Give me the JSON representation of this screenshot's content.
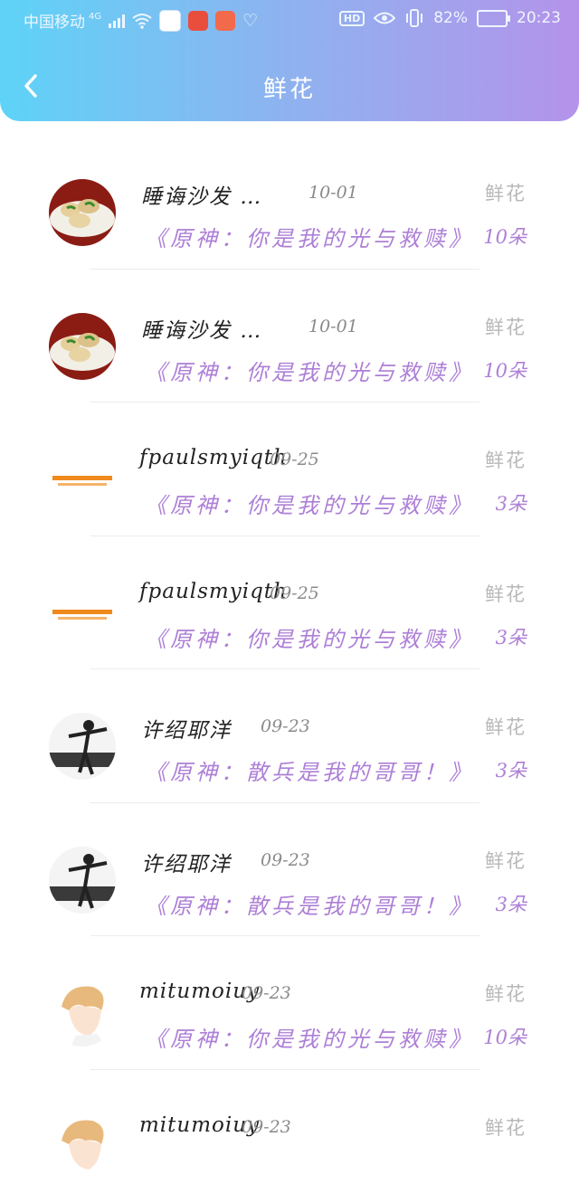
{
  "status_bar": {
    "carrier": "中国移动",
    "network": "4G",
    "battery_percent": "82%",
    "time": "20:23"
  },
  "header": {
    "title": "鲜花",
    "back_icon": "chevron-left-icon"
  },
  "records": [
    {
      "name": "睡诲沙发 …",
      "date": "10-01",
      "kind": "鲜花",
      "work": "《原神：你是我的光与救赎》",
      "count": "10朵",
      "avatar": "food-dumplings"
    },
    {
      "name": "睡诲沙发 …",
      "date": "10-01",
      "kind": "鲜花",
      "work": "《原神：你是我的光与救赎》",
      "count": "10朵",
      "avatar": "food-dumplings"
    },
    {
      "name": "fpaulsmyiqth",
      "date": "09-25",
      "kind": "鲜花",
      "work": "《原神：你是我的光与救赎》",
      "count": "3朵",
      "avatar": "text-logo"
    },
    {
      "name": "fpaulsmyiqth",
      "date": "09-25",
      "kind": "鲜花",
      "work": "《原神：你是我的光与救赎》",
      "count": "3朵",
      "avatar": "text-logo"
    },
    {
      "name": "许绍耶洋",
      "date": "09-23",
      "kind": "鲜花",
      "work": "《原神：散兵是我的哥哥！》",
      "count": "3朵",
      "avatar": "dancer-photo"
    },
    {
      "name": "许绍耶洋",
      "date": "09-23",
      "kind": "鲜花",
      "work": "《原神：散兵是我的哥哥！》",
      "count": "3朵",
      "avatar": "dancer-photo"
    },
    {
      "name": "mitumoiuy",
      "date": "09-23",
      "kind": "鲜花",
      "work": "《原神：你是我的光与救赎》",
      "count": "10朵",
      "avatar": "anime-boy"
    },
    {
      "name": "mitumoiuy",
      "date": "09-23",
      "kind": "鲜花",
      "work": "",
      "count": "",
      "avatar": "anime-boy"
    }
  ],
  "colors": {
    "accent_purple": "#ad7fd6",
    "header_gradient_start": "#5ed3f7",
    "header_gradient_end": "#b493ea"
  }
}
